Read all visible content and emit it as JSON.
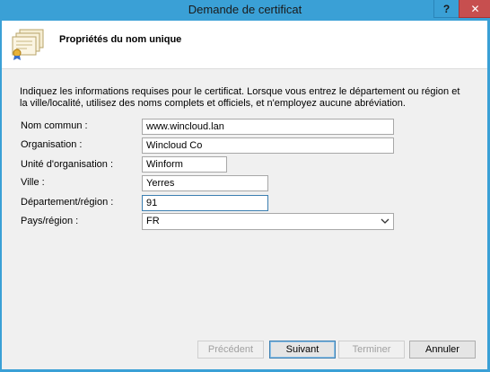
{
  "window": {
    "title": "Demande de certificat",
    "help_label": "?",
    "close_label": "✕"
  },
  "header": {
    "title": "Propriétés du nom unique"
  },
  "intro": "Indiquez les informations requises pour le certificat. Lorsque vous entrez le département ou région et la ville/localité, utilisez des noms complets et officiels, et n'employez aucune abréviation.",
  "fields": {
    "common_name": {
      "label": "Nom commun :",
      "value": "www.wincloud.lan"
    },
    "organization": {
      "label": "Organisation :",
      "value": "Wincloud Co"
    },
    "org_unit": {
      "label": "Unité d'organisation :",
      "value": "Winform"
    },
    "city": {
      "label": "Ville :",
      "value": "Yerres"
    },
    "state": {
      "label": "Département/région :",
      "value": "91"
    },
    "country": {
      "label": "Pays/région :",
      "value": "FR"
    }
  },
  "buttons": {
    "previous": "Précédent",
    "next": "Suivant",
    "finish": "Terminer",
    "cancel": "Annuler"
  },
  "colors": {
    "titlebar": "#3aa0d6",
    "close": "#c74f4f",
    "dialog_bg": "#f0f0f0",
    "focus_border": "#3c7fb1"
  }
}
